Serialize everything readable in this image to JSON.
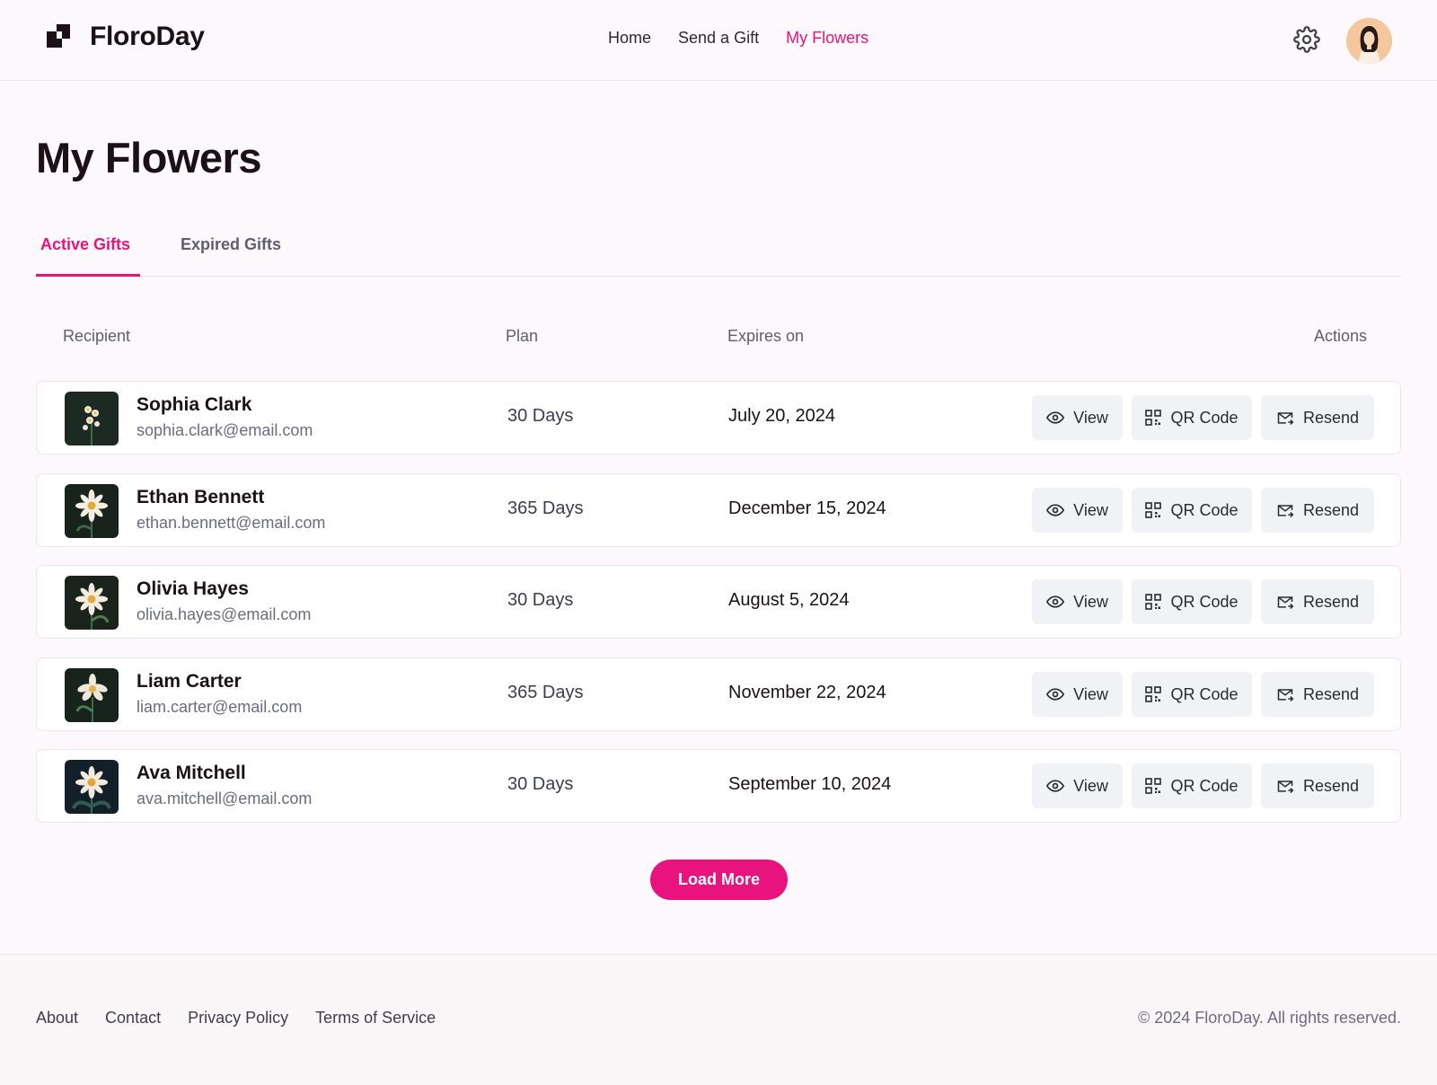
{
  "brand": {
    "name": "FloroDay"
  },
  "nav": {
    "items": [
      "Home",
      "Send a Gift",
      "My Flowers"
    ],
    "active": "My Flowers"
  },
  "page": {
    "title": "My Flowers"
  },
  "tabs": {
    "active_label": "Active Gifts",
    "inactive_label": "Expired Gifts"
  },
  "table": {
    "headers": {
      "recipient": "Recipient",
      "plan": "Plan",
      "expires": "Expires on",
      "actions": "Actions"
    },
    "rows": [
      {
        "name": "Sophia Clark",
        "email": "sophia.clark@email.com",
        "plan": "30 Days",
        "expires": "July 20, 2024"
      },
      {
        "name": "Ethan Bennett",
        "email": "ethan.bennett@email.com",
        "plan": "365 Days",
        "expires": "December 15, 2024"
      },
      {
        "name": "Olivia Hayes",
        "email": "olivia.hayes@email.com",
        "plan": "30 Days",
        "expires": "August 5, 2024"
      },
      {
        "name": "Liam Carter",
        "email": "liam.carter@email.com",
        "plan": "365 Days",
        "expires": "November 22, 2024"
      },
      {
        "name": "Ava Mitchell",
        "email": "ava.mitchell@email.com",
        "plan": "30 Days",
        "expires": "September 10, 2024"
      }
    ],
    "actions": {
      "view": "View",
      "qr": "QR Code",
      "resend": "Resend"
    }
  },
  "load_more": "Load More",
  "footer": {
    "links": [
      "About",
      "Contact",
      "Privacy Policy",
      "Terms of Service"
    ],
    "copyright": "© 2024 FloroDay. All rights reserved."
  },
  "colors": {
    "accent": "#e8137c",
    "background": "#fcf8fb",
    "text": "#1b1117",
    "muted": "#6b6c7e",
    "button_bg": "#f1f2f5"
  },
  "icons": {
    "logo": "floroday-logo-icon",
    "settings": "gear-icon",
    "view": "eye-icon",
    "qr": "qr-code-icon",
    "resend": "mail-resend-icon"
  }
}
